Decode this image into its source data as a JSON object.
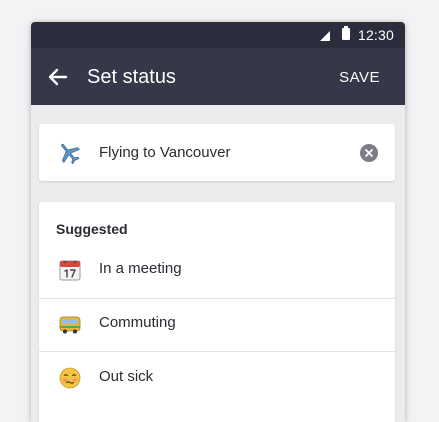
{
  "status_bar": {
    "time": "12:30"
  },
  "app_bar": {
    "back_icon": "arrow-left-icon",
    "title": "Set status",
    "save_label": "SAVE"
  },
  "current_status": {
    "emoji_icon": "airplane-icon",
    "text": "Flying to Vancouver",
    "clear_icon": "clear-icon"
  },
  "suggested": {
    "heading": "Suggested",
    "items": [
      {
        "icon": "calendar-icon",
        "label": "In a meeting"
      },
      {
        "icon": "bus-icon",
        "label": "Commuting"
      },
      {
        "icon": "sick-face-icon",
        "label": "Out sick"
      }
    ]
  },
  "colors": {
    "status_bar": "#2c2d3c",
    "app_bar": "#363748",
    "background": "#ececee",
    "card": "#ffffff",
    "text": "#2b2b33"
  }
}
